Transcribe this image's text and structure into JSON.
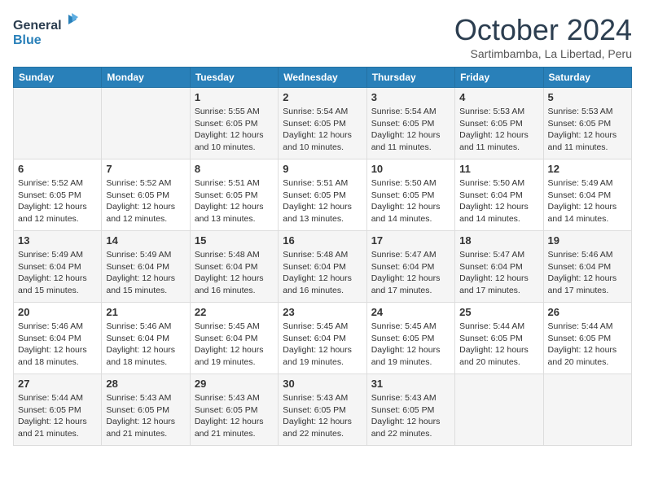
{
  "header": {
    "logo_general": "General",
    "logo_blue": "Blue",
    "month_title": "October 2024",
    "subtitle": "Sartimbamba, La Libertad, Peru"
  },
  "weekdays": [
    "Sunday",
    "Monday",
    "Tuesday",
    "Wednesday",
    "Thursday",
    "Friday",
    "Saturday"
  ],
  "rows": [
    [
      {
        "day": "",
        "sunrise": "",
        "sunset": "",
        "daylight": ""
      },
      {
        "day": "",
        "sunrise": "",
        "sunset": "",
        "daylight": ""
      },
      {
        "day": "1",
        "sunrise": "Sunrise: 5:55 AM",
        "sunset": "Sunset: 6:05 PM",
        "daylight": "Daylight: 12 hours and 10 minutes."
      },
      {
        "day": "2",
        "sunrise": "Sunrise: 5:54 AM",
        "sunset": "Sunset: 6:05 PM",
        "daylight": "Daylight: 12 hours and 10 minutes."
      },
      {
        "day": "3",
        "sunrise": "Sunrise: 5:54 AM",
        "sunset": "Sunset: 6:05 PM",
        "daylight": "Daylight: 12 hours and 11 minutes."
      },
      {
        "day": "4",
        "sunrise": "Sunrise: 5:53 AM",
        "sunset": "Sunset: 6:05 PM",
        "daylight": "Daylight: 12 hours and 11 minutes."
      },
      {
        "day": "5",
        "sunrise": "Sunrise: 5:53 AM",
        "sunset": "Sunset: 6:05 PM",
        "daylight": "Daylight: 12 hours and 11 minutes."
      }
    ],
    [
      {
        "day": "6",
        "sunrise": "Sunrise: 5:52 AM",
        "sunset": "Sunset: 6:05 PM",
        "daylight": "Daylight: 12 hours and 12 minutes."
      },
      {
        "day": "7",
        "sunrise": "Sunrise: 5:52 AM",
        "sunset": "Sunset: 6:05 PM",
        "daylight": "Daylight: 12 hours and 12 minutes."
      },
      {
        "day": "8",
        "sunrise": "Sunrise: 5:51 AM",
        "sunset": "Sunset: 6:05 PM",
        "daylight": "Daylight: 12 hours and 13 minutes."
      },
      {
        "day": "9",
        "sunrise": "Sunrise: 5:51 AM",
        "sunset": "Sunset: 6:05 PM",
        "daylight": "Daylight: 12 hours and 13 minutes."
      },
      {
        "day": "10",
        "sunrise": "Sunrise: 5:50 AM",
        "sunset": "Sunset: 6:05 PM",
        "daylight": "Daylight: 12 hours and 14 minutes."
      },
      {
        "day": "11",
        "sunrise": "Sunrise: 5:50 AM",
        "sunset": "Sunset: 6:04 PM",
        "daylight": "Daylight: 12 hours and 14 minutes."
      },
      {
        "day": "12",
        "sunrise": "Sunrise: 5:49 AM",
        "sunset": "Sunset: 6:04 PM",
        "daylight": "Daylight: 12 hours and 14 minutes."
      }
    ],
    [
      {
        "day": "13",
        "sunrise": "Sunrise: 5:49 AM",
        "sunset": "Sunset: 6:04 PM",
        "daylight": "Daylight: 12 hours and 15 minutes."
      },
      {
        "day": "14",
        "sunrise": "Sunrise: 5:49 AM",
        "sunset": "Sunset: 6:04 PM",
        "daylight": "Daylight: 12 hours and 15 minutes."
      },
      {
        "day": "15",
        "sunrise": "Sunrise: 5:48 AM",
        "sunset": "Sunset: 6:04 PM",
        "daylight": "Daylight: 12 hours and 16 minutes."
      },
      {
        "day": "16",
        "sunrise": "Sunrise: 5:48 AM",
        "sunset": "Sunset: 6:04 PM",
        "daylight": "Daylight: 12 hours and 16 minutes."
      },
      {
        "day": "17",
        "sunrise": "Sunrise: 5:47 AM",
        "sunset": "Sunset: 6:04 PM",
        "daylight": "Daylight: 12 hours and 17 minutes."
      },
      {
        "day": "18",
        "sunrise": "Sunrise: 5:47 AM",
        "sunset": "Sunset: 6:04 PM",
        "daylight": "Daylight: 12 hours and 17 minutes."
      },
      {
        "day": "19",
        "sunrise": "Sunrise: 5:46 AM",
        "sunset": "Sunset: 6:04 PM",
        "daylight": "Daylight: 12 hours and 17 minutes."
      }
    ],
    [
      {
        "day": "20",
        "sunrise": "Sunrise: 5:46 AM",
        "sunset": "Sunset: 6:04 PM",
        "daylight": "Daylight: 12 hours and 18 minutes."
      },
      {
        "day": "21",
        "sunrise": "Sunrise: 5:46 AM",
        "sunset": "Sunset: 6:04 PM",
        "daylight": "Daylight: 12 hours and 18 minutes."
      },
      {
        "day": "22",
        "sunrise": "Sunrise: 5:45 AM",
        "sunset": "Sunset: 6:04 PM",
        "daylight": "Daylight: 12 hours and 19 minutes."
      },
      {
        "day": "23",
        "sunrise": "Sunrise: 5:45 AM",
        "sunset": "Sunset: 6:04 PM",
        "daylight": "Daylight: 12 hours and 19 minutes."
      },
      {
        "day": "24",
        "sunrise": "Sunrise: 5:45 AM",
        "sunset": "Sunset: 6:05 PM",
        "daylight": "Daylight: 12 hours and 19 minutes."
      },
      {
        "day": "25",
        "sunrise": "Sunrise: 5:44 AM",
        "sunset": "Sunset: 6:05 PM",
        "daylight": "Daylight: 12 hours and 20 minutes."
      },
      {
        "day": "26",
        "sunrise": "Sunrise: 5:44 AM",
        "sunset": "Sunset: 6:05 PM",
        "daylight": "Daylight: 12 hours and 20 minutes."
      }
    ],
    [
      {
        "day": "27",
        "sunrise": "Sunrise: 5:44 AM",
        "sunset": "Sunset: 6:05 PM",
        "daylight": "Daylight: 12 hours and 21 minutes."
      },
      {
        "day": "28",
        "sunrise": "Sunrise: 5:43 AM",
        "sunset": "Sunset: 6:05 PM",
        "daylight": "Daylight: 12 hours and 21 minutes."
      },
      {
        "day": "29",
        "sunrise": "Sunrise: 5:43 AM",
        "sunset": "Sunset: 6:05 PM",
        "daylight": "Daylight: 12 hours and 21 minutes."
      },
      {
        "day": "30",
        "sunrise": "Sunrise: 5:43 AM",
        "sunset": "Sunset: 6:05 PM",
        "daylight": "Daylight: 12 hours and 22 minutes."
      },
      {
        "day": "31",
        "sunrise": "Sunrise: 5:43 AM",
        "sunset": "Sunset: 6:05 PM",
        "daylight": "Daylight: 12 hours and 22 minutes."
      },
      {
        "day": "",
        "sunrise": "",
        "sunset": "",
        "daylight": ""
      },
      {
        "day": "",
        "sunrise": "",
        "sunset": "",
        "daylight": ""
      }
    ]
  ]
}
